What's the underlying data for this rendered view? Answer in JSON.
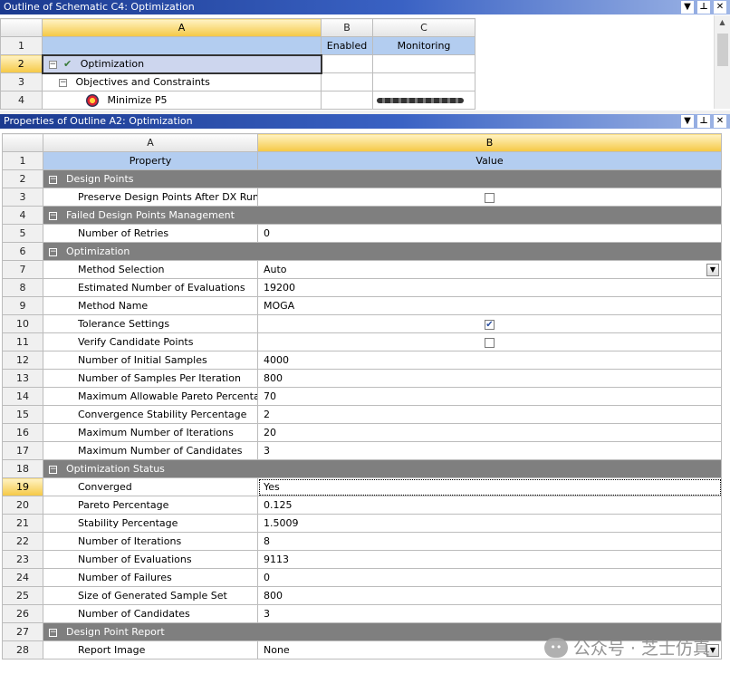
{
  "outline": {
    "title": "Outline of Schematic C4: Optimization",
    "col_letters": [
      "A",
      "B",
      "C"
    ],
    "header_row": {
      "num": "1",
      "b": "Enabled",
      "c": "Monitoring"
    },
    "rows": [
      {
        "num": "2",
        "label": "Optimization"
      },
      {
        "num": "3",
        "label": "Objectives and Constraints"
      },
      {
        "num": "4",
        "label": "Minimize P5"
      }
    ]
  },
  "properties": {
    "title": "Properties of Outline A2: Optimization",
    "col_letters": [
      "A",
      "B"
    ],
    "header_row": {
      "num": "1",
      "property": "Property",
      "value": "Value"
    },
    "rows": [
      {
        "num": "2",
        "type": "section",
        "label": "Design Points"
      },
      {
        "num": "3",
        "type": "checkbox",
        "label": "Preserve Design Points After DX Run",
        "checked": false
      },
      {
        "num": "4",
        "type": "section",
        "label": "Failed Design Points Management"
      },
      {
        "num": "5",
        "type": "text",
        "label": "Number of Retries",
        "value": "0"
      },
      {
        "num": "6",
        "type": "section",
        "label": "Optimization"
      },
      {
        "num": "7",
        "type": "dropdown",
        "label": "Method Selection",
        "value": "Auto"
      },
      {
        "num": "8",
        "type": "text",
        "label": "Estimated Number of Evaluations",
        "value": "19200"
      },
      {
        "num": "9",
        "type": "text",
        "label": "Method Name",
        "value": "MOGA"
      },
      {
        "num": "10",
        "type": "checkbox",
        "label": "Tolerance Settings",
        "checked": true
      },
      {
        "num": "11",
        "type": "checkbox",
        "label": "Verify Candidate Points",
        "checked": false
      },
      {
        "num": "12",
        "type": "text",
        "label": "Number of Initial Samples",
        "value": "4000"
      },
      {
        "num": "13",
        "type": "text",
        "label": "Number of Samples Per Iteration",
        "value": "800"
      },
      {
        "num": "14",
        "type": "text",
        "label": "Maximum Allowable Pareto Percentage",
        "value": "70"
      },
      {
        "num": "15",
        "type": "text",
        "label": "Convergence Stability Percentage",
        "value": "2"
      },
      {
        "num": "16",
        "type": "text",
        "label": "Maximum Number of Iterations",
        "value": "20"
      },
      {
        "num": "17",
        "type": "text",
        "label": "Maximum Number of Candidates",
        "value": "3"
      },
      {
        "num": "18",
        "type": "section",
        "label": "Optimization Status"
      },
      {
        "num": "19",
        "type": "text",
        "label": "Converged",
        "value": "Yes",
        "selected": true
      },
      {
        "num": "20",
        "type": "text",
        "label": "Pareto Percentage",
        "value": "0.125"
      },
      {
        "num": "21",
        "type": "text",
        "label": "Stability Percentage",
        "value": "1.5009"
      },
      {
        "num": "22",
        "type": "text",
        "label": "Number of Iterations",
        "value": "8"
      },
      {
        "num": "23",
        "type": "text",
        "label": "Number of Evaluations",
        "value": "9113"
      },
      {
        "num": "24",
        "type": "text",
        "label": "Number of Failures",
        "value": "0"
      },
      {
        "num": "25",
        "type": "text",
        "label": "Size of Generated Sample Set",
        "value": "800"
      },
      {
        "num": "26",
        "type": "text",
        "label": "Number of Candidates",
        "value": "3"
      },
      {
        "num": "27",
        "type": "section",
        "label": "Design Point Report"
      },
      {
        "num": "28",
        "type": "dropdown",
        "label": "Report Image",
        "value": "None"
      }
    ]
  },
  "window_buttons": {
    "dropdown": "▼",
    "pin": "⊥",
    "close": "✕"
  },
  "watermark": "公众号 · 芝士仿真",
  "icons": {
    "check": "check-icon",
    "collapse": "minus-box-icon",
    "goal": "goal-icon"
  },
  "colors": {
    "section": "#7f7f7f",
    "header_blue": "#b3cdf0",
    "selected_header": "#f5c843",
    "title_bar": "#1b3a8f"
  }
}
